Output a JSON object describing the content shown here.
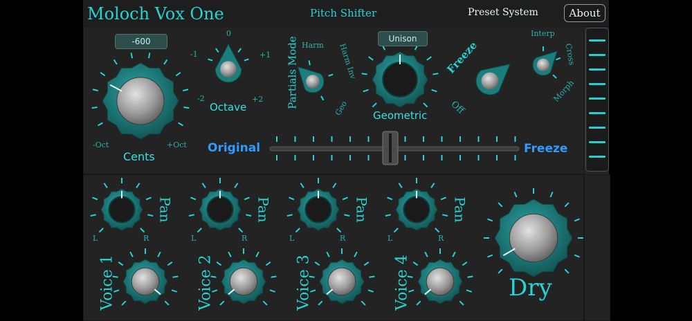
{
  "header": {
    "app_title": "Moloch Vox One",
    "plugin_name": "Pitch Shifter",
    "preset_label": "Preset System",
    "about_label": "About"
  },
  "pitch": {
    "cents_value": "-600",
    "cents_label": "Cents",
    "cents_min": "-Oct",
    "cents_max": "+Oct",
    "octave_label": "Octave",
    "octave_marks": [
      "0",
      "-1",
      "+1",
      "-2",
      "+2"
    ],
    "partials_label": "Partials Mode",
    "partials_marks": [
      "Harm",
      "Harm Inv",
      "Geo"
    ],
    "mode_value": "Unison",
    "mode_label": "Geometric",
    "freeze_label": "Freeze",
    "freeze_off": "Off",
    "interp_marks": [
      "Interp",
      "Cross",
      "Morph"
    ],
    "crossfade_left": "Original",
    "crossfade_right": "Freeze"
  },
  "voices": [
    {
      "label": "Voice 1",
      "pan_label": "Pan",
      "pan_left": "L",
      "pan_right": "R"
    },
    {
      "label": "Voice 2",
      "pan_label": "Pan",
      "pan_left": "L",
      "pan_right": "R"
    },
    {
      "label": "Voice 3",
      "pan_label": "Pan",
      "pan_left": "L",
      "pan_right": "R"
    },
    {
      "label": "Voice 4",
      "pan_label": "Pan",
      "pan_left": "L",
      "pan_right": "R"
    }
  ],
  "dry": {
    "label": "Dry"
  },
  "colors": {
    "accent": "#26d4d4",
    "knob_teal": "#1b7d7c",
    "background": "#262626",
    "blue_label": "#2e9bff"
  },
  "icons": [
    "side-meter-icon"
  ]
}
